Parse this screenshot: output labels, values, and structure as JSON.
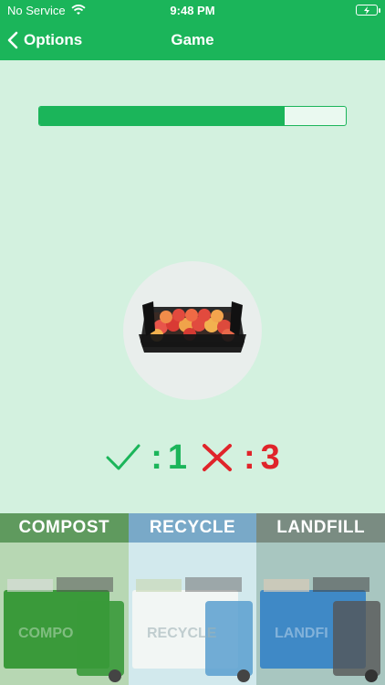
{
  "status": {
    "carrier": "No Service",
    "time": "9:48 PM"
  },
  "nav": {
    "back_label": "Options",
    "title": "Game"
  },
  "progress": {
    "value": 0.8
  },
  "score": {
    "correct": "1",
    "wrong": "3",
    "separator": ":"
  },
  "bins": [
    {
      "label": "COMPOST",
      "header_color": "#5f9a5e",
      "body_color": "#b7d7b3",
      "dumpster_color": "#3a9a3a"
    },
    {
      "label": "RECYCLE",
      "header_color": "#79a9c8",
      "body_color": "#d2e9ed",
      "dumpster_color": "#f2f6f4"
    },
    {
      "label": "LANDFILL",
      "header_color": "#7a8c82",
      "body_color": "#a8c6c0",
      "dumpster_color": "#3f89c6"
    }
  ],
  "colors": {
    "brand": "#1bb55a",
    "wrong": "#e0242a",
    "background": "#d3f1df"
  }
}
